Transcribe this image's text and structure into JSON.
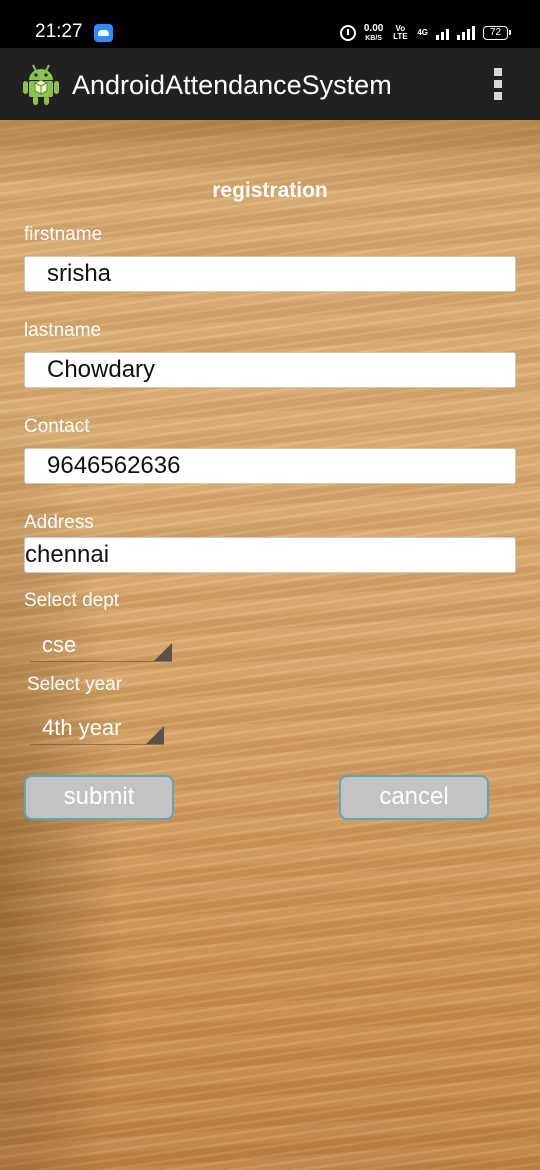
{
  "status_bar": {
    "time": "21:27",
    "net_speed_value": "0.00",
    "net_speed_unit": "KB/S",
    "volte": "Vo LTE",
    "network_type": "4G",
    "battery": "72"
  },
  "app_bar": {
    "title": "AndroidAttendanceSystem",
    "app_icon": "android-robot-icon",
    "menu_icon": "overflow-menu-icon"
  },
  "form": {
    "heading": "registration",
    "firstname_label": "firstname",
    "firstname_value": "srisha",
    "lastname_label": "lastname",
    "lastname_value": "Chowdary",
    "contact_label": "Contact",
    "contact_value": "9646562636",
    "address_label": "Address",
    "address_value": "chennai",
    "dept_label": "Select dept",
    "dept_value": "cse",
    "year_label": "Select year",
    "year_value": "4th year"
  },
  "buttons": {
    "submit": "submit",
    "cancel": "cancel"
  },
  "colors": {
    "action_bar": "#212121",
    "wood_background": "#d6a264",
    "button_fill": "#c3c3c3",
    "button_border": "#5fa6b8",
    "android_green": "#8bc34a"
  }
}
